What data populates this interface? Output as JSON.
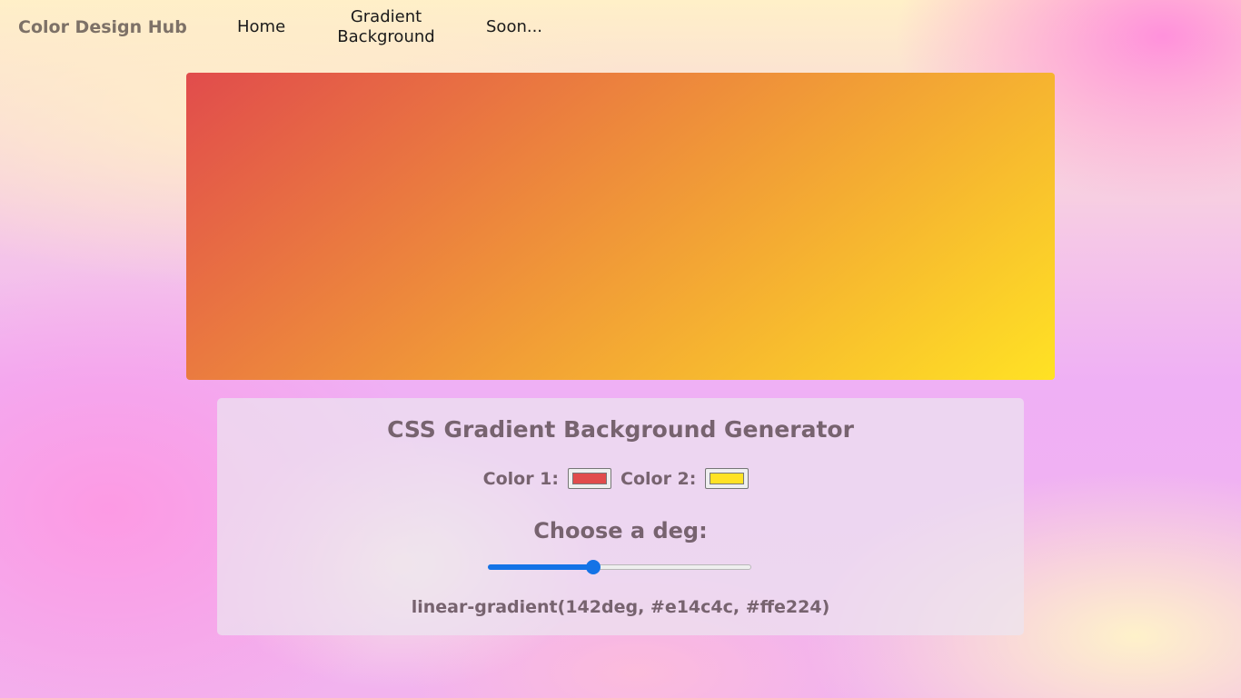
{
  "nav": {
    "brand": "Color Design Hub",
    "links": [
      "Home",
      "Gradient Background",
      "Soon..."
    ]
  },
  "preview": {
    "angle_deg": 142,
    "color1": "#e14c4c",
    "color2": "#ffe224"
  },
  "panel": {
    "title": "CSS Gradient Background Generator",
    "color1_label": "Color 1:",
    "color1_value": "#e14c4c",
    "color2_label": "Color 2:",
    "color2_value": "#ffe224",
    "deg_label": "Choose a deg:",
    "deg_slider": {
      "value": 142,
      "min": 0,
      "max": 360
    },
    "css_output": "linear-gradient(142deg, #e14c4c, #ffe224)"
  },
  "colors": {
    "slider_accent": "#1473e6",
    "panel_text": "#77636f",
    "brand_text": "#7d7167"
  }
}
